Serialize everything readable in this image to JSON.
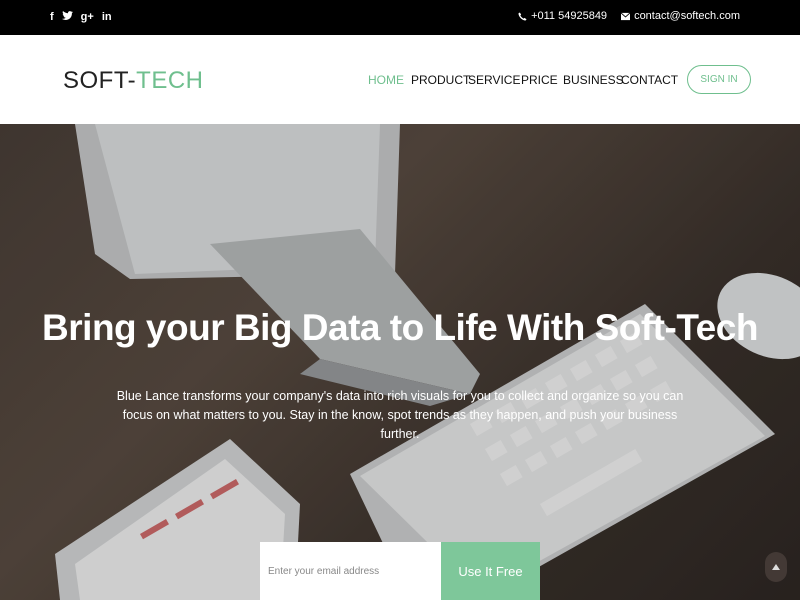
{
  "topbar": {
    "social": [
      {
        "icon": "facebook-icon",
        "glyph": "f"
      },
      {
        "icon": "twitter-icon",
        "glyph": "t"
      },
      {
        "icon": "google-plus-icon",
        "glyph": "g+"
      },
      {
        "icon": "linkedin-icon",
        "glyph": "in"
      }
    ],
    "phone": "+011 54925849",
    "email": "contact@softech.com"
  },
  "header": {
    "logo_part1": "SOFT-",
    "logo_part2": "TECH",
    "nav": [
      "HOME",
      "PRODUCT",
      "SERVICE",
      "PRICE",
      "BUSINESS",
      "CONTACT"
    ],
    "active_nav": "HOME",
    "signin_label": "SIGN IN"
  },
  "hero": {
    "title": "Bring your Big Data to Life With Soft-Tech",
    "text": "Blue Lance transforms your company's data into rich visuals for you to collect and organize so you can focus on what matters to you. Stay in the know, spot trends as they happen, and push your business further.",
    "email_placeholder": "Enter your email address",
    "cta_label": "Use It Free"
  },
  "colors": {
    "accent": "#6fbf8e",
    "cta": "#7ec79a",
    "topbar": "#000000"
  }
}
